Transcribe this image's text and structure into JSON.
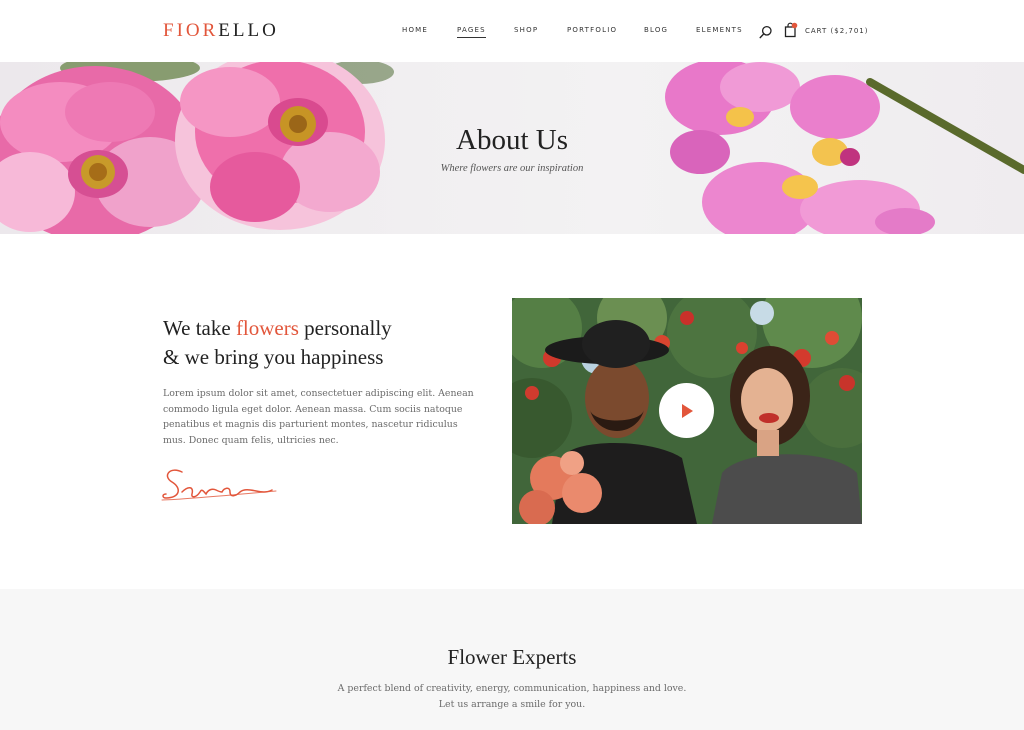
{
  "brand": {
    "logo_part1": "FIOR",
    "logo_part2": "ELLO",
    "accent_color": "#e2563b"
  },
  "nav": {
    "items": [
      {
        "label": "HOME",
        "active": false
      },
      {
        "label": "PAGES",
        "active": true
      },
      {
        "label": "SHOP",
        "active": false
      },
      {
        "label": "PORTFOLIO",
        "active": false
      },
      {
        "label": "BLOG",
        "active": false
      },
      {
        "label": "ELEMENTS",
        "active": false
      }
    ],
    "search_icon": "search-icon",
    "cart_icon": "shopping-bag-icon",
    "cart_label": "CART ($2,701)"
  },
  "hero": {
    "title": "About Us",
    "subtitle": "Where flowers are our inspiration"
  },
  "intro": {
    "heading_pre": "We take ",
    "heading_accent": "flowers",
    "heading_post": " personally",
    "heading_line2": "& we bring you happiness",
    "body": "Lorem ipsum dolor sit amet, consectetuer adipiscing elit. Aenean commodo ligula eget dolor. Aenean massa. Cum sociis natoque penatibus et magnis dis parturient montes, nascetur ridiculus mus. Donec quam felis, ultricies nec.",
    "signature": "Sara"
  },
  "video": {
    "play_icon": "play-icon"
  },
  "experts": {
    "title": "Flower Experts",
    "text": "A perfect blend of creativity, energy, communication, happiness and love. Let us arrange a smile for you."
  }
}
